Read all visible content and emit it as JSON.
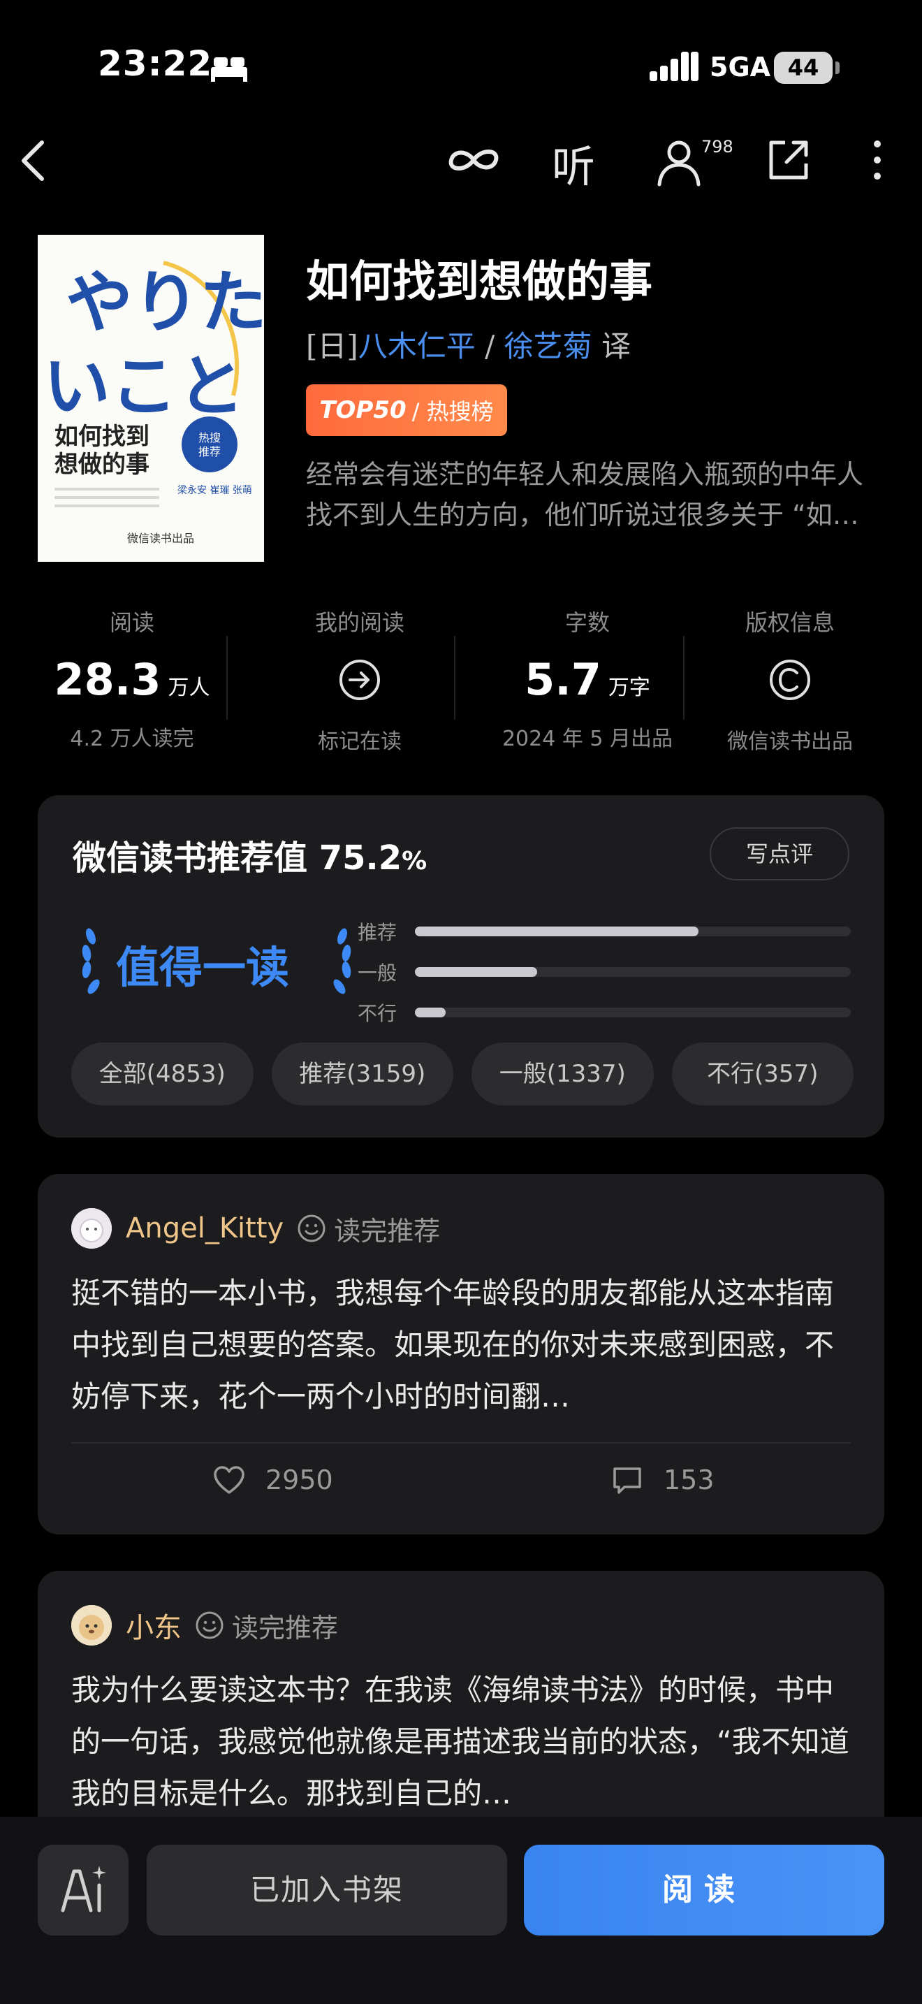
{
  "status_bar": {
    "time": "23:22",
    "network": "5GA",
    "battery": "44"
  },
  "nav": {
    "listen_label": "听",
    "follower_count": "798"
  },
  "book": {
    "title": "如何找到想做的事",
    "author_prefix": "[日]",
    "author": "八木仁平",
    "separator": "/",
    "translator": "徐艺菊",
    "translator_suffix": "译",
    "rank_top": "TOP50",
    "rank_label": "/ 热搜榜",
    "description": "经常会有迷茫的年轻人和发展陷入瓶颈的中年人找不到人生的方向，他们听说过很多关于 “如…"
  },
  "cover": {
    "jp_text": "やりたいこと",
    "cn_title_line1": "如何找到",
    "cn_title_line2": "想做的事",
    "badge_line1": "热搜",
    "badge_line2": "推荐",
    "recommenders": "梁永安 崔璀 张萌",
    "publisher": "微信读书出品"
  },
  "stats": [
    {
      "label": "阅读",
      "value": "28.3",
      "unit": "万人",
      "sub": "4.2 万人读完"
    },
    {
      "label": "我的阅读",
      "icon": "arrow-circle-icon",
      "sub": "标记在读"
    },
    {
      "label": "字数",
      "value": "5.7",
      "unit": "万字",
      "sub": "2024 年 5 月出品"
    },
    {
      "label": "版权信息",
      "icon": "copyright-icon",
      "sub": "微信读书出品"
    }
  ],
  "recommend": {
    "title": "微信读书推荐值 75.2",
    "pct_sign": "%",
    "write_review": "写点评",
    "verdict": "值得一读",
    "bars": [
      {
        "label": "推荐",
        "fraction": 0.65
      },
      {
        "label": "一般",
        "fraction": 0.28
      },
      {
        "label": "不行",
        "fraction": 0.07
      }
    ],
    "filters": [
      "全部(4853)",
      "推荐(3159)",
      "一般(1337)",
      "不行(357)"
    ]
  },
  "reviews": [
    {
      "user": "Angel_Kitty",
      "tag": "读完推荐",
      "text": "挺不错的一本小书，我想每个年龄段的朋友都能从这本指南中找到自己想要的答案。如果现在的你对未来感到困惑，不妨停下来，花个一两个小时的时间翻…",
      "likes": "2950",
      "comments": "153"
    },
    {
      "user": "小东",
      "tag": "读完推荐",
      "text": "我为什么要读这本书？在我读《海绵读书法》的时候，书中的一句话，我感觉他就像是再描述我当前的状态，“我不知道我的目标是什么。那找到自己的…"
    }
  ],
  "bottom": {
    "ai_label": "AI",
    "shelf_label": "已加入书架",
    "read_label": "阅读"
  },
  "colors": {
    "accent_blue": "#3d8af7",
    "rank_orange": "#ff6a3d",
    "username_gold": "#f0c58a",
    "card_bg": "#1c1c1e"
  }
}
